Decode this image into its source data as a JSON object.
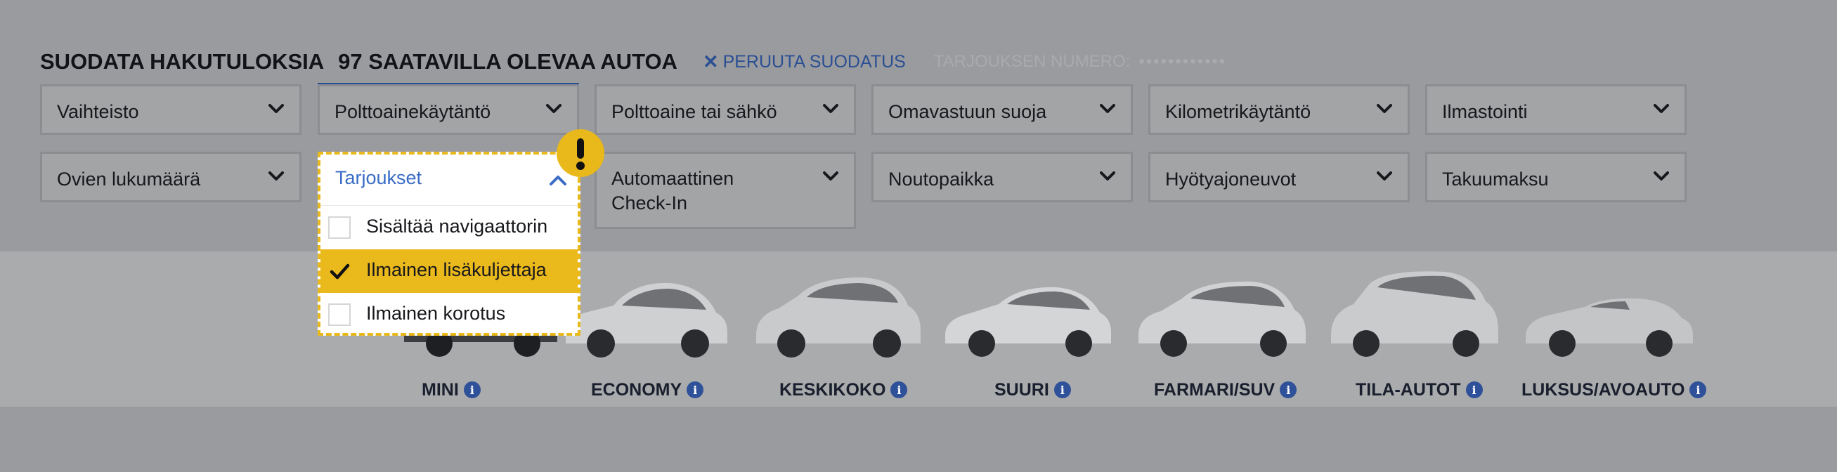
{
  "header": {
    "title": "SUODATA HAKUTULOKSIA",
    "count": "97 SAATAVILLA OLEVAA AUTOA",
    "cancel_icon": "x-icon",
    "cancel": "PERUUTA SUODATUS",
    "offer_label": "TARJOUKSEN NUMERO:",
    "offer_value": "••••••••••••"
  },
  "filters": {
    "row1": [
      "Vaihteisto",
      "Polttoainekäytäntö",
      "Polttoaine tai sähkö",
      "Omavastuun suoja",
      "Kilometrikäytäntö",
      "Ilmastointi"
    ],
    "row2": [
      "Ovien lukumäärä",
      "Automaattinen",
      "Check-In",
      "Noutopaikka",
      "Hyötyajoneuvot",
      "Takuumaksu"
    ]
  },
  "dropdown": {
    "title": "Tarjoukset",
    "options": [
      {
        "label": "Sisältää navigaattorin",
        "checked": false
      },
      {
        "label": "Ilmainen lisäkuljettaja",
        "checked": true
      },
      {
        "label": "Ilmainen korotus",
        "checked": false
      }
    ]
  },
  "categories": [
    "MINI",
    "ECONOMY",
    "KESKIKOKO",
    "SUURI",
    "FARMARI/SUV",
    "TILA-AUTOT",
    "LUKSUS/AVOAUTO"
  ],
  "info_glyph": "i",
  "alert_icon": "exclamation-icon",
  "colors": {
    "overlay": "#9a9b9e",
    "accent_blue": "#2a4f93",
    "link_blue": "#3a6cc5",
    "highlight_yellow": "#eab91c",
    "info_blue": "#2e5199"
  }
}
